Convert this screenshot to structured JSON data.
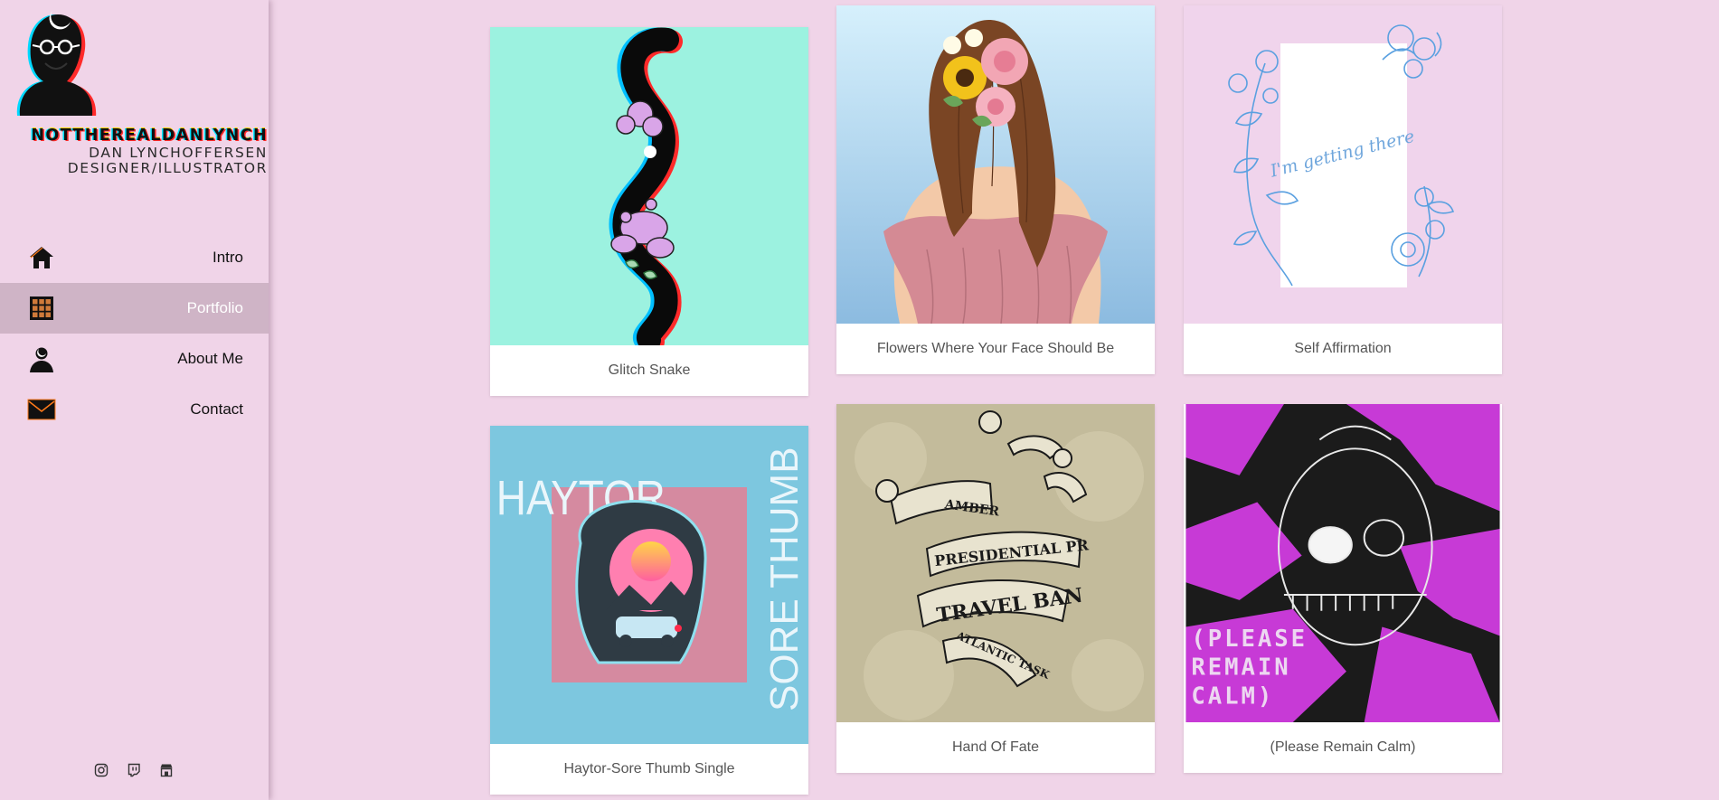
{
  "brand": {
    "name": "NOTTHEREALDANLYNCH",
    "subtitle_line1": "DAN LYNCHOFFERSEN",
    "subtitle_line2": "DESIGNER/ILLUSTRATOR"
  },
  "nav": {
    "active": "Portfolio",
    "items": [
      {
        "label": "Intro",
        "icon": "home-icon"
      },
      {
        "label": "Portfolio",
        "icon": "grid-icon"
      },
      {
        "label": "About Me",
        "icon": "person-icon"
      },
      {
        "label": "Contact",
        "icon": "envelope-icon"
      }
    ]
  },
  "socials": [
    {
      "name": "instagram-icon"
    },
    {
      "name": "twitch-icon"
    },
    {
      "name": "store-icon"
    }
  ],
  "gallery": [
    {
      "title": "Glitch Snake"
    },
    {
      "title": "Flowers Where Your Face Should Be"
    },
    {
      "title": "Self Affirmation",
      "art_text": "I'm getting there"
    },
    {
      "title": "Haytor-Sore Thumb Single",
      "art_text_1": "HAYTOR",
      "art_text_2": "SORE THUMB"
    },
    {
      "title": "Hand Of Fate",
      "art_text_1": "TRAVEL BAN",
      "art_text_2": "PRESIDENTIAL PR",
      "art_text_3": "AMBER",
      "art_text_4": "ATLANTIC TASK"
    },
    {
      "title": "(Please Remain Calm)",
      "art_text_1": "(PLEASE",
      "art_text_2": "REMAIN",
      "art_text_3": "CALM)"
    }
  ],
  "colors": {
    "page_bg": "#f0d4e8",
    "nav_active_bg": "#cfb4c6",
    "caption_text": "#555555"
  }
}
